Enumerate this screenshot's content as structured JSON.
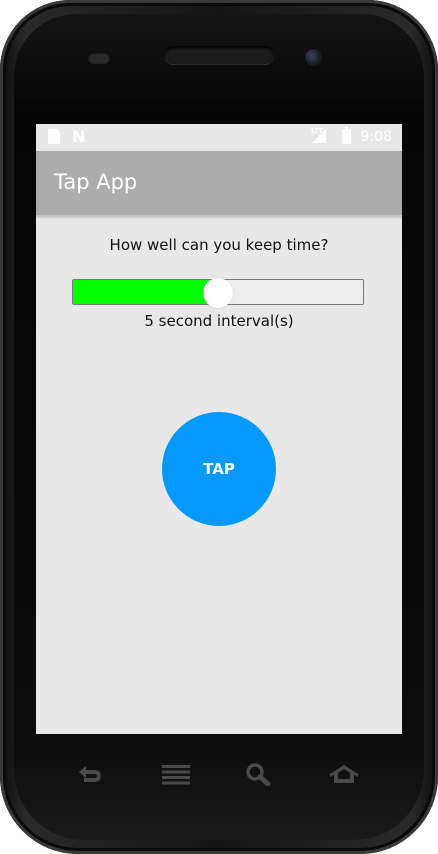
{
  "status_bar": {
    "notification_icons": [
      "sd-card-icon",
      "n-notification-icon"
    ],
    "n_glyph": "N",
    "network_label": "LTE",
    "time": "9:08"
  },
  "toolbar": {
    "title": "Tap App"
  },
  "main": {
    "prompt": "How well can you keep time?",
    "slider": {
      "fraction": 0.5,
      "fill_color": "#00ff00"
    },
    "interval_label": "5 second interval(s)",
    "tap_button": {
      "label": "TAP",
      "color": "#0599fc"
    }
  },
  "nav_bar": {
    "buttons": [
      "back-icon",
      "menu-icon",
      "search-icon",
      "home-icon"
    ]
  },
  "colors": {
    "toolbar": "#acacac",
    "screen_background": "#e8e8e8"
  }
}
